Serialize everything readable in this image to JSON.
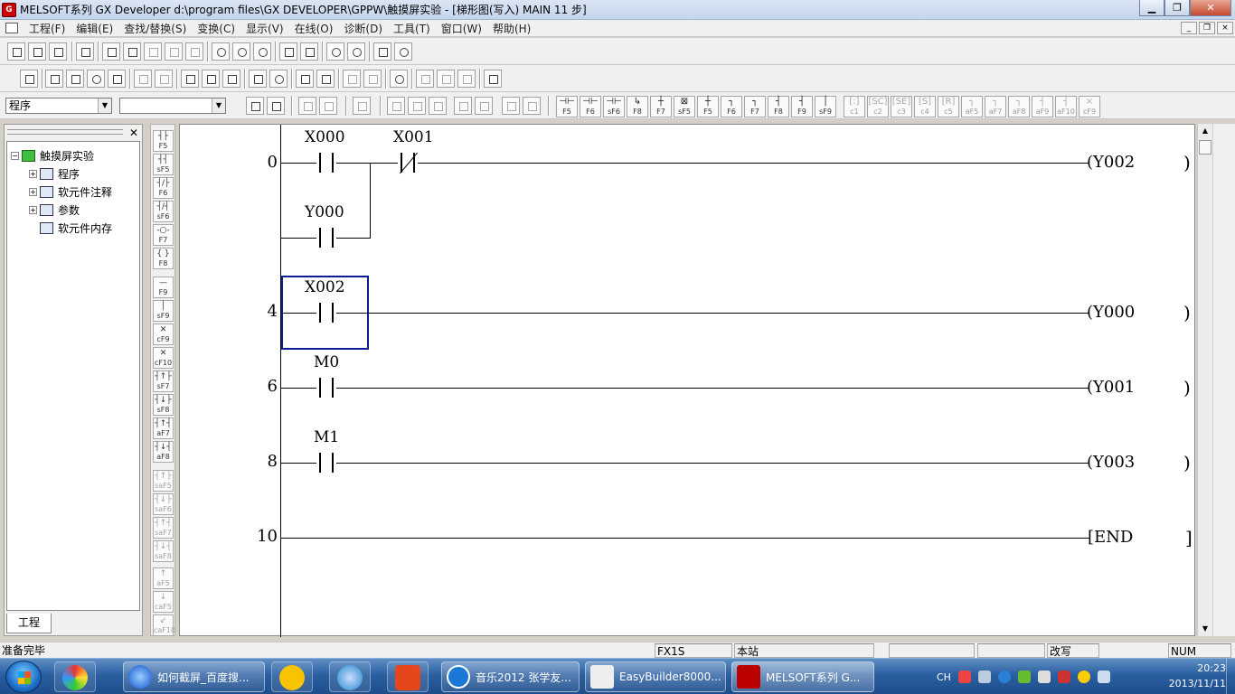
{
  "window": {
    "title": "MELSOFT系列 GX Developer d:\\program files\\GX DEVELOPER\\GPPW\\触摸屏实验 - [梯形图(写入)    MAIN    11 步]",
    "min": "▁",
    "max": "❐",
    "close": "✕",
    "mdi_min": "_",
    "mdi_max": "❐",
    "mdi_close": "×"
  },
  "menu": [
    "工程(F)",
    "编辑(E)",
    "查找/替换(S)",
    "变换(C)",
    "显示(V)",
    "在线(O)",
    "诊断(D)",
    "工具(T)",
    "窗口(W)",
    "帮助(H)"
  ],
  "toolbar": {
    "combo_left": "程序",
    "combo_right": "",
    "combo_arrow": "▼"
  },
  "fkeys": {
    "row": [
      {
        "g": "⊣⊢",
        "k": "F5"
      },
      {
        "g": "⊣⊢",
        "k": "F6"
      },
      {
        "g": "⊣⊢",
        "k": "sF6"
      },
      {
        "g": "↳",
        "k": "F8"
      },
      {
        "g": "┼",
        "k": "F7"
      },
      {
        "g": "⊠",
        "k": "sF5"
      },
      {
        "g": "┼",
        "k": "F5"
      },
      {
        "g": "┐",
        "k": "F6"
      },
      {
        "g": "┐",
        "k": "F7"
      },
      {
        "g": "┤",
        "k": "F8"
      },
      {
        "g": "┤",
        "k": "F9"
      },
      {
        "g": "│",
        "k": "sF9"
      },
      {
        "g": "[:]",
        "k": "c1"
      },
      {
        "g": "[SC]",
        "k": "c2"
      },
      {
        "g": "[SE]",
        "k": "c3"
      },
      {
        "g": "[S]",
        "k": "c4"
      },
      {
        "g": "[R]",
        "k": "c5"
      },
      {
        "g": "┐",
        "k": "aF5"
      },
      {
        "g": "┐",
        "k": "aF7"
      },
      {
        "g": "┐",
        "k": "aF8"
      },
      {
        "g": "┤",
        "k": "aF9"
      },
      {
        "g": "┤",
        "k": "aF10"
      },
      {
        "g": "×",
        "k": "cF9"
      }
    ],
    "vertical": [
      {
        "g": "┤├",
        "k": "F5"
      },
      {
        "g": "┤┤",
        "k": "sF5"
      },
      {
        "g": "┤/├",
        "k": "F6"
      },
      {
        "g": "┤/┤",
        "k": "sF6"
      },
      {
        "g": "-○-",
        "k": "F7"
      },
      {
        "g": "{ }",
        "k": "F8"
      },
      {
        "g": "—",
        "k": "F9"
      },
      {
        "g": "│",
        "k": "sF9"
      },
      {
        "g": "✕",
        "k": "cF9"
      },
      {
        "g": "✕",
        "k": "cF10"
      },
      {
        "g": "┤↑├",
        "k": "sF7"
      },
      {
        "g": "┤↓├",
        "k": "sF8"
      },
      {
        "g": "┤↑┤",
        "k": "aF7"
      },
      {
        "g": "┤↓┤",
        "k": "aF8"
      },
      {
        "g": "┤↑├",
        "k": "saF5"
      },
      {
        "g": "┤↓├",
        "k": "saF6"
      },
      {
        "g": "┤↑┤",
        "k": "saF7"
      },
      {
        "g": "┤↓┤",
        "k": "saF8"
      },
      {
        "g": "↑",
        "k": "aF5"
      },
      {
        "g": "↓",
        "k": "caF5"
      },
      {
        "g": "↙",
        "k": "caF10"
      }
    ]
  },
  "project": {
    "close": "✕",
    "root": "触摸屏实验",
    "items": [
      {
        "label": "程序",
        "exp": "+"
      },
      {
        "label": "软元件注释",
        "exp": "+"
      },
      {
        "label": "参数",
        "exp": "+"
      },
      {
        "label": "软元件内存",
        "exp": ""
      }
    ],
    "root_exp": "−",
    "tab": "工程"
  },
  "ladder": {
    "steps": [
      "0",
      "4",
      "6",
      "8",
      "10"
    ],
    "devices": {
      "x000": "X000",
      "x001": "X001",
      "y000_contact": "Y000",
      "x002": "X002",
      "m0": "M0",
      "m1": "M1"
    },
    "coils": [
      "(Y002",
      "(Y000",
      "(Y001",
      "(Y003"
    ],
    "coil_close": ")",
    "end": "[END",
    "end_close": "]"
  },
  "scroll": {
    "up": "▲",
    "down": "▼"
  },
  "status": {
    "ready": "准备完毕",
    "plc": "FX1S",
    "station": "本站",
    "blank1": "",
    "blank2": "",
    "mode": "改写",
    "num": "NUM"
  },
  "taskbar": {
    "tasks": [
      "如何截屏_百度搜...",
      "音乐2012 张学友...",
      "EasyBuilder8000...",
      "MELSOFT系列 G..."
    ],
    "lang": "CH",
    "time": "20:23",
    "date": "2013/11/11"
  }
}
